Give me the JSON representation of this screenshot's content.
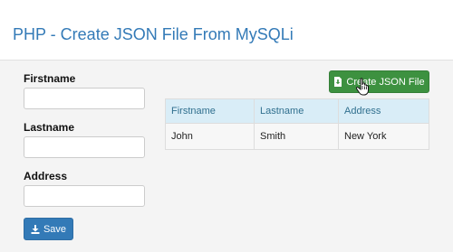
{
  "header": {
    "title": "PHP - Create JSON File From MySQLi"
  },
  "form": {
    "fields": [
      {
        "label": "Firstname",
        "value": "",
        "placeholder": ""
      },
      {
        "label": "Lastname",
        "value": "",
        "placeholder": ""
      },
      {
        "label": "Address",
        "value": "",
        "placeholder": ""
      }
    ],
    "save_label": "Save",
    "save_icon": "download-icon"
  },
  "actions": {
    "create_json_label": "Create JSON File",
    "create_json_icon": "file-download-icon"
  },
  "table": {
    "headers": [
      "Firstname",
      "Lastname",
      "Address"
    ],
    "rows": [
      [
        "John",
        "Smith",
        "New York"
      ]
    ]
  },
  "colors": {
    "title": "#337ab7",
    "save_button": "#337ab7",
    "create_button": "#3d9140",
    "table_header_bg": "#d9edf7",
    "table_header_text": "#31708f"
  }
}
